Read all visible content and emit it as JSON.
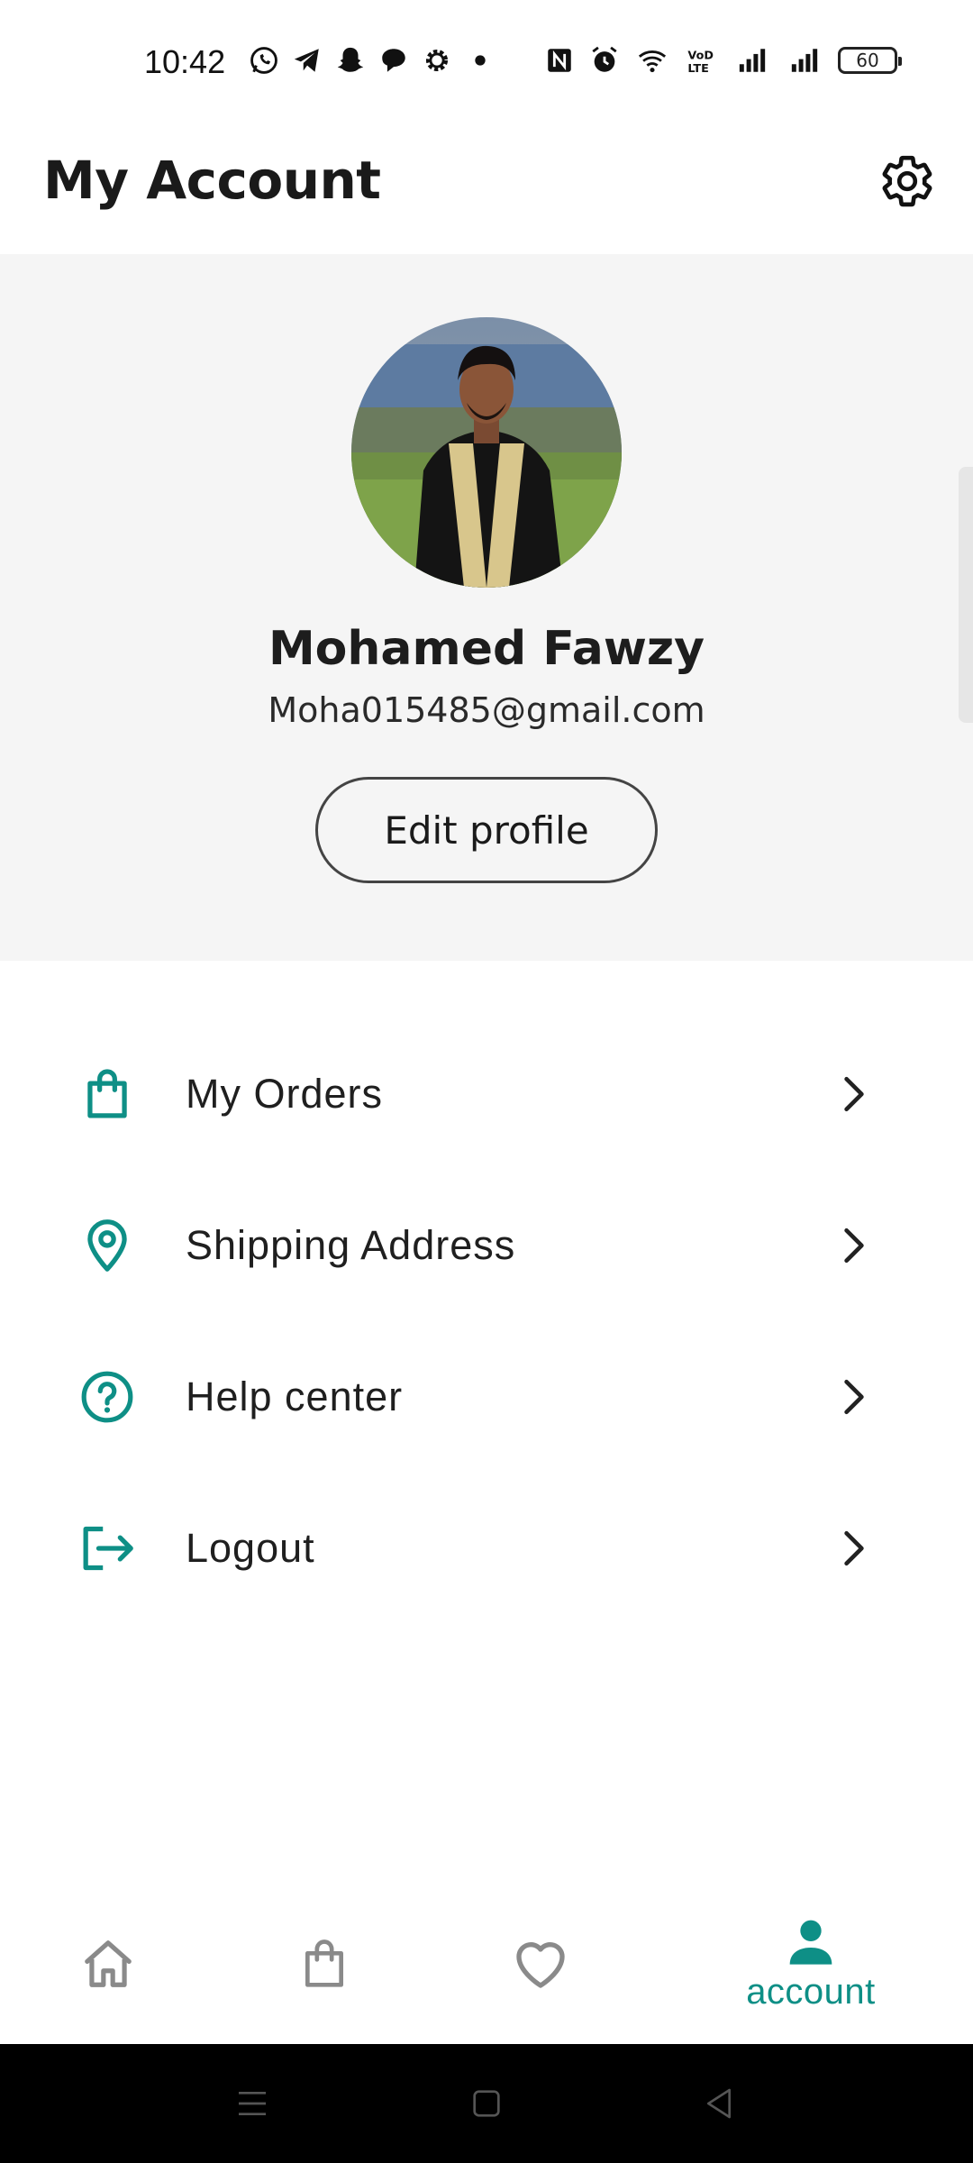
{
  "status_bar": {
    "time": "10:42",
    "battery": "60",
    "icons": [
      "whatsapp-icon",
      "telegram-icon",
      "snapchat-icon",
      "chat-bubble-icon",
      "settings-cog-icon",
      "dot-icon",
      "nfc-icon",
      "alarm-icon",
      "wifi-icon",
      "volte-icon",
      "signal-icon",
      "signal-icon",
      "battery-icon"
    ]
  },
  "header": {
    "title": "My Account",
    "settings_icon": "gear-icon"
  },
  "profile": {
    "name": "Mohamed Fawzy",
    "email": "Moha015485@gmail.com",
    "edit_label": "Edit profile"
  },
  "menu": {
    "items": [
      {
        "label": "My Orders",
        "icon": "shopping-bag-icon"
      },
      {
        "label": "Shipping Address",
        "icon": "location-pin-icon"
      },
      {
        "label": "Help center",
        "icon": "help-circle-icon"
      },
      {
        "label": "Logout",
        "icon": "logout-icon"
      }
    ]
  },
  "bottom_nav": {
    "items": [
      {
        "icon": "home-icon",
        "label": ""
      },
      {
        "icon": "shopping-bag-icon",
        "label": ""
      },
      {
        "icon": "heart-icon",
        "label": ""
      },
      {
        "icon": "person-icon",
        "label": "account",
        "active": true
      }
    ]
  },
  "colors": {
    "accent": "#0e8f86",
    "profile_bg": "#f5f5f5",
    "text": "#1c1c1c"
  }
}
